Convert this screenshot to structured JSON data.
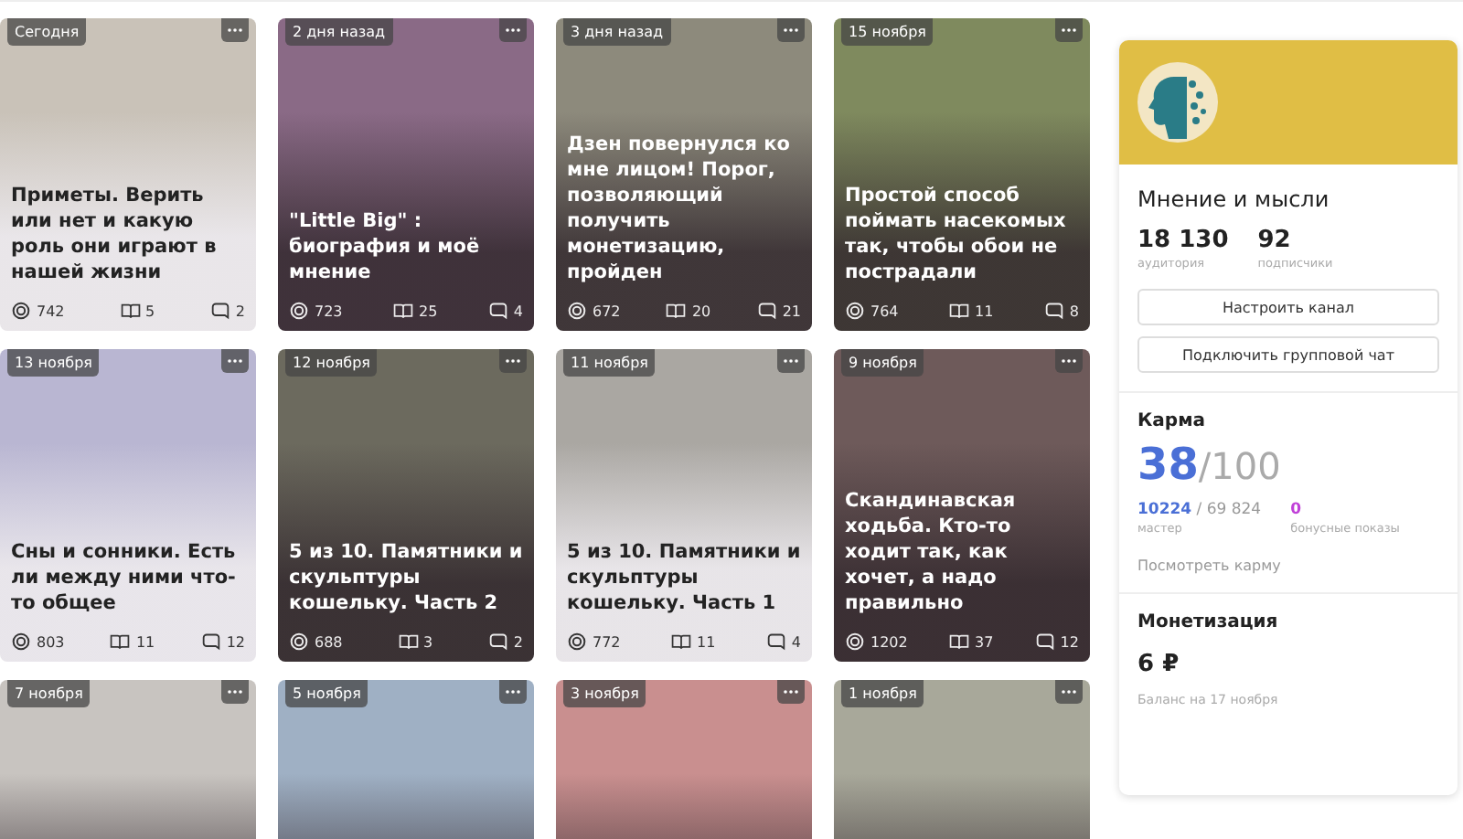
{
  "cards": [
    {
      "date": "Сегодня",
      "title": "Приметы. Верить или нет и какую роль они играют в нашей жизни",
      "views": "742",
      "reads": "5",
      "comments": "2"
    },
    {
      "date": "2 дня назад",
      "title": "\"Little Big\" : биография и моё мнение",
      "views": "723",
      "reads": "25",
      "comments": "4"
    },
    {
      "date": "3 дня назад",
      "title": "Дзен повернулся ко мне лицом! Порог, позволяющий получить монетизацию, пройден",
      "views": "672",
      "reads": "20",
      "comments": "21"
    },
    {
      "date": "15 ноября",
      "title": "Простой способ поймать насекомых так, чтобы обои не пострадали",
      "views": "764",
      "reads": "11",
      "comments": "8"
    },
    {
      "date": "13 ноября",
      "title": "Сны и сонники. Есть ли между ними что-то общее",
      "views": "803",
      "reads": "11",
      "comments": "12"
    },
    {
      "date": "12 ноября",
      "title": "5 из 10. Памятники и скульптуры кошельку. Часть 2",
      "views": "688",
      "reads": "3",
      "comments": "2"
    },
    {
      "date": "11 ноября",
      "title": "5 из 10. Памятники и скульптуры кошельку. Часть 1",
      "views": "772",
      "reads": "11",
      "comments": "4"
    },
    {
      "date": "9 ноября",
      "title": "Скандинавская ходьба. Кто-то ходит так, как хочет, а надо правильно",
      "views": "1202",
      "reads": "37",
      "comments": "12"
    },
    {
      "date": "7 ноября"
    },
    {
      "date": "5 ноября"
    },
    {
      "date": "3 ноября"
    },
    {
      "date": "1 ноября"
    }
  ],
  "channel": {
    "name": "Мнение и мысли",
    "stats": [
      {
        "value": "18 130",
        "label": "аудитория"
      },
      {
        "value": "92",
        "label": "подписчики"
      }
    ],
    "buttons": [
      "Настроить канал",
      "Подключить групповой чат"
    ]
  },
  "karma": {
    "title": "Карма",
    "score": "38",
    "max": "/100",
    "points": "10224",
    "total": " / 69 824",
    "points_label": "мастер",
    "bonus": "0",
    "bonus_label": "бонусные показы",
    "link": "Посмотреть карму"
  },
  "monetization": {
    "title": "Монетизация",
    "amount": "6 ₽",
    "note": "Баланс на 17 ноября"
  }
}
